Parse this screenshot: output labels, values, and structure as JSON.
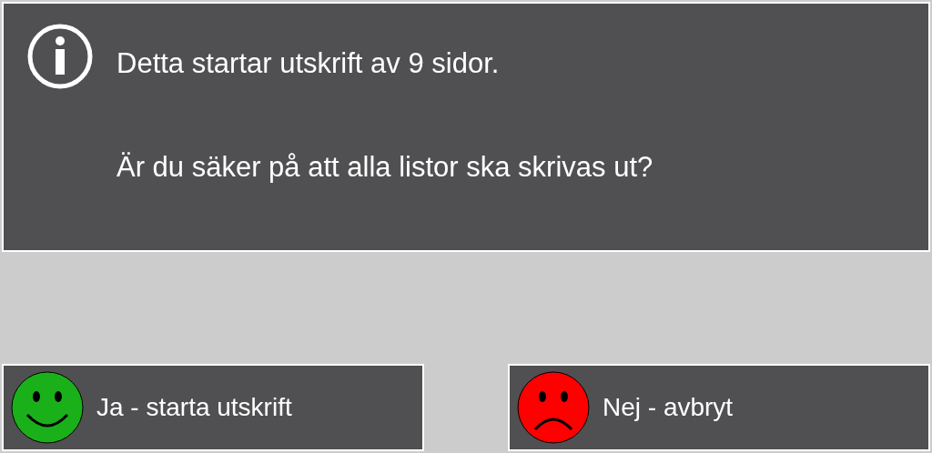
{
  "message": {
    "lines": [
      "Detta startar utskrift av 9 sidor.",
      "Är du säker på att alla listor ska skrivas ut?"
    ]
  },
  "buttons": [
    {
      "label": "Ja - starta utskrift",
      "kind": "happy",
      "color": "#1ab01a"
    },
    {
      "label": "Nej - avbryt",
      "kind": "sad",
      "color": "#ff0000"
    }
  ]
}
